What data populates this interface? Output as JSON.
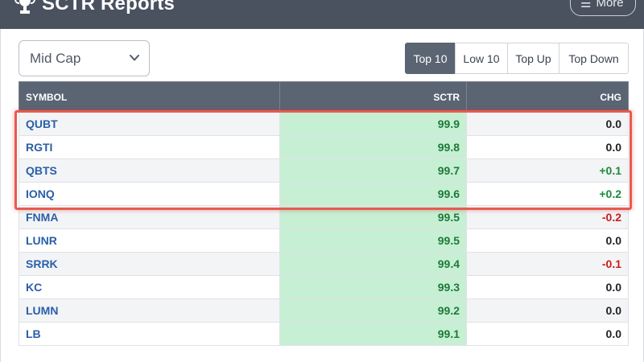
{
  "header": {
    "title": "SCTR Reports",
    "icon": "trophy-icon",
    "more_label": "More",
    "more_icon": "menu-icon"
  },
  "filter": {
    "selected": "Mid Cap"
  },
  "tabs": [
    {
      "label": "Top 10",
      "active": true
    },
    {
      "label": "Low 10",
      "active": false
    },
    {
      "label": "Top Up",
      "active": false
    },
    {
      "label": "Top Down",
      "active": false
    }
  ],
  "table": {
    "columns": [
      "SYMBOL",
      "SCTR",
      "CHG"
    ],
    "rows": [
      {
        "symbol": "QUBT",
        "sctr": "99.9",
        "chg": "0.0",
        "dir": "flat"
      },
      {
        "symbol": "RGTI",
        "sctr": "99.8",
        "chg": "0.0",
        "dir": "flat"
      },
      {
        "symbol": "QBTS",
        "sctr": "99.7",
        "chg": "+0.1",
        "dir": "pos"
      },
      {
        "symbol": "IONQ",
        "sctr": "99.6",
        "chg": "+0.2",
        "dir": "pos"
      },
      {
        "symbol": "FNMA",
        "sctr": "99.5",
        "chg": "-0.2",
        "dir": "neg"
      },
      {
        "symbol": "LUNR",
        "sctr": "99.5",
        "chg": "0.0",
        "dir": "flat"
      },
      {
        "symbol": "SRRK",
        "sctr": "99.4",
        "chg": "-0.1",
        "dir": "neg"
      },
      {
        "symbol": "KC",
        "sctr": "99.3",
        "chg": "0.0",
        "dir": "flat"
      },
      {
        "symbol": "LUMN",
        "sctr": "99.2",
        "chg": "0.0",
        "dir": "flat"
      },
      {
        "symbol": "LB",
        "sctr": "99.1",
        "chg": "0.0",
        "dir": "flat"
      }
    ]
  },
  "annotation": {
    "type": "highlight-box",
    "color": "#e85a4f",
    "highlighted_symbols": [
      "QUBT",
      "RGTI",
      "QBTS",
      "IONQ"
    ]
  },
  "colors": {
    "header_bg": "#4a5260",
    "active_tab_bg": "#5a6472",
    "sctr_cell_bg": "#c7efd4",
    "positive": "#1d8a3c",
    "negative": "#cc1d1d",
    "symbol_link": "#2a5fa8"
  }
}
